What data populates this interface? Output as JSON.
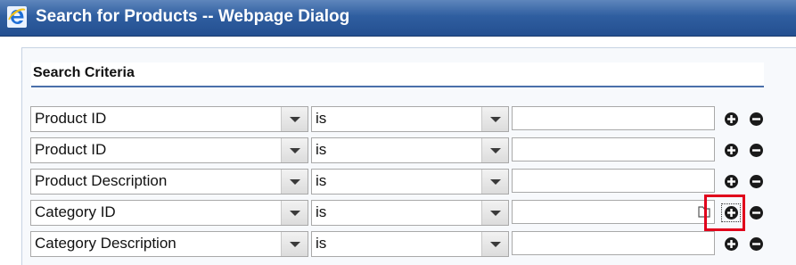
{
  "window": {
    "title": "Search for Products -- Webpage Dialog"
  },
  "section": {
    "title": "Search Criteria"
  },
  "rows": [
    {
      "field": "Product ID",
      "operator": "is",
      "value": ""
    },
    {
      "field": "Product ID",
      "operator": "is",
      "value": ""
    },
    {
      "field": "Product Description",
      "operator": "is",
      "value": ""
    },
    {
      "field": "Category ID",
      "operator": "is",
      "value": "",
      "has_lookup": true
    },
    {
      "field": "Category Description",
      "operator": "is",
      "value": ""
    }
  ],
  "icons": {
    "title_icon": "ie-icon",
    "add": "plus-circle-icon",
    "remove": "minus-circle-icon",
    "lookup": "folder-icon",
    "dropdown": "chevron-down-icon"
  },
  "colors": {
    "titlebar": "#2f5ea0",
    "section_rule": "#4a6faa",
    "highlight": "#e0001b"
  }
}
